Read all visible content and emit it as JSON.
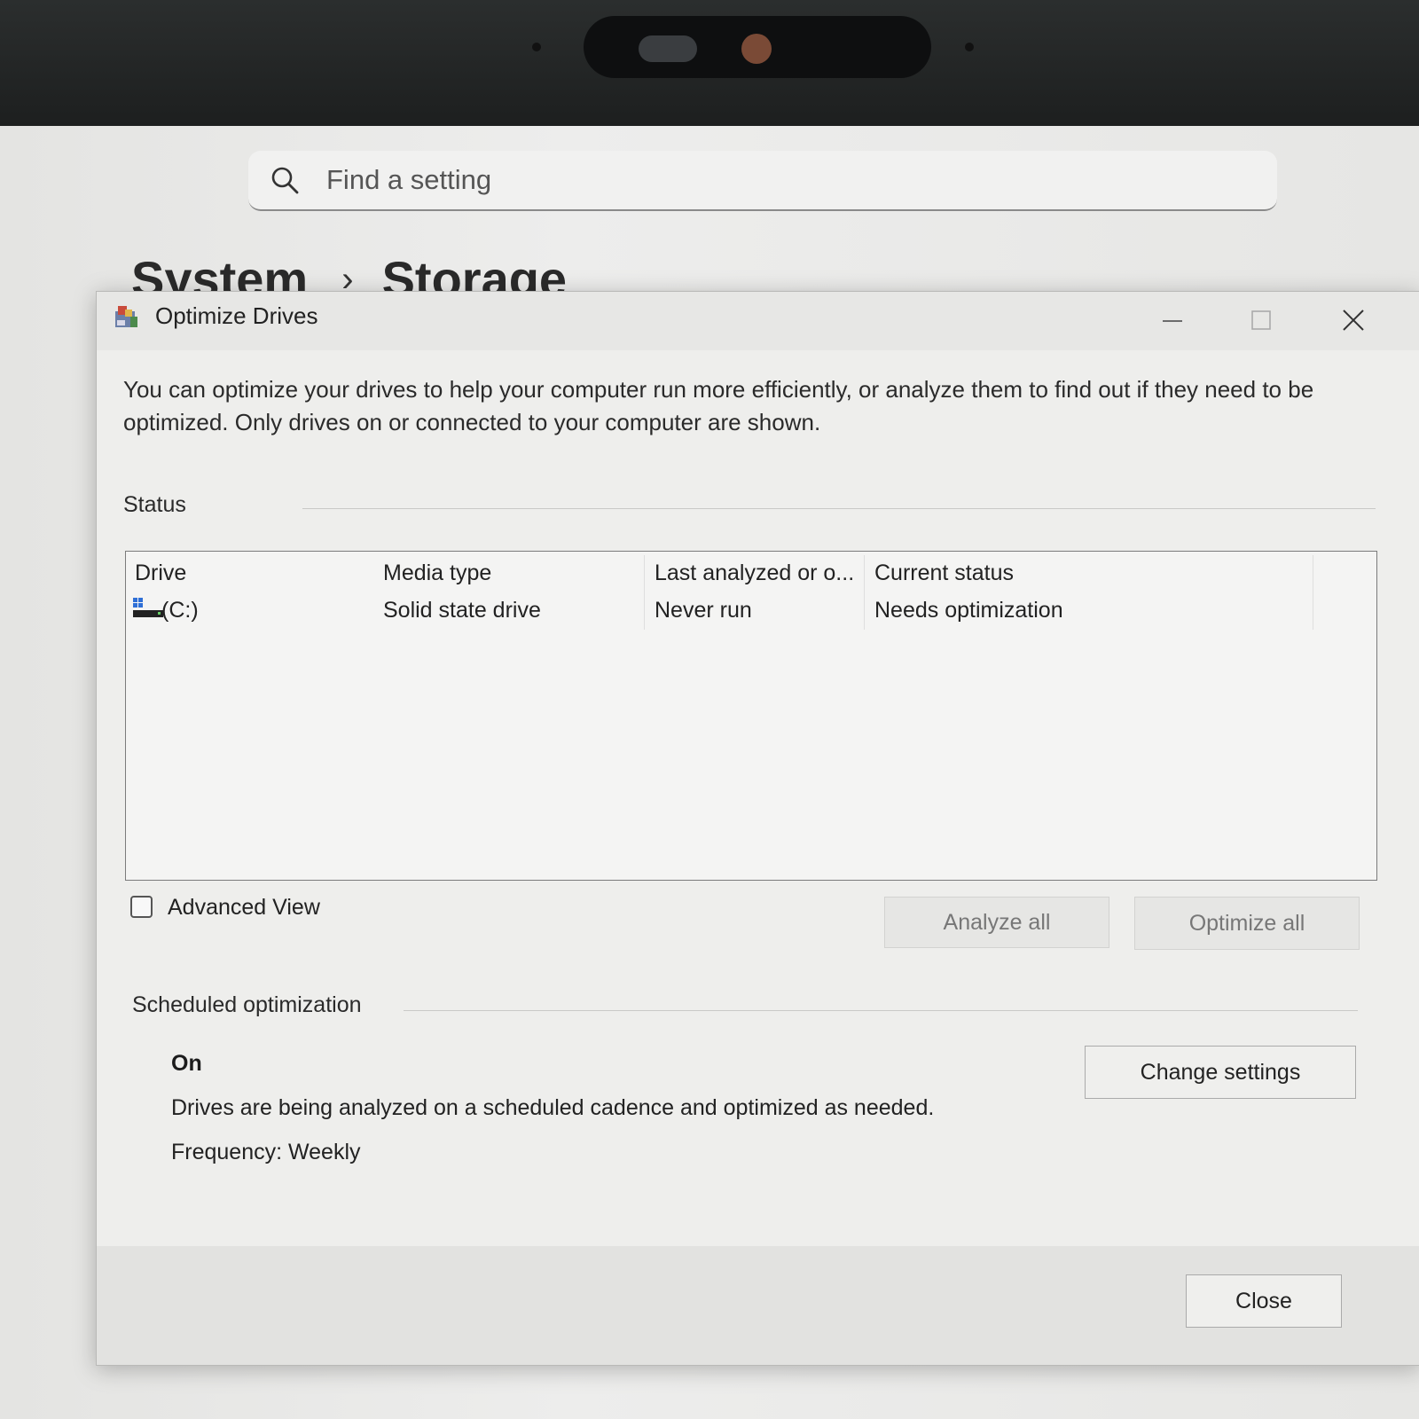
{
  "settings": {
    "search": {
      "placeholder": "Find a setting"
    },
    "breadcrumb": {
      "parent": "System",
      "separator": "›",
      "current": "Storage"
    }
  },
  "dialog": {
    "title": "Optimize Drives",
    "intro": "You can optimize your drives to help your computer run more efficiently, or analyze them to find out if they need to be optimized. Only drives on or connected to your computer are shown.",
    "status_label": "Status",
    "columns": [
      "Drive",
      "Media type",
      "Last analyzed or o...",
      "Current status"
    ],
    "drives": [
      {
        "drive": "(C:)",
        "media_type": "Solid state drive",
        "last_analyzed": "Never run",
        "current_status": "Needs optimization"
      }
    ],
    "advanced_view_label": "Advanced View",
    "analyze_all": "Analyze all",
    "optimize_all": "Optimize all",
    "scheduled_label": "Scheduled optimization",
    "schedule_state": "On",
    "schedule_description": "Drives are being analyzed on a scheduled cadence and optimized as needed.",
    "schedule_frequency": "Frequency: Weekly",
    "change_settings": "Change settings",
    "close": "Close"
  },
  "icons": {
    "search": "search-icon",
    "app": "defrag-app-icon",
    "drive": "drive-icon",
    "minimize": "minimize-icon",
    "maximize": "maximize-icon",
    "close": "close-icon"
  }
}
